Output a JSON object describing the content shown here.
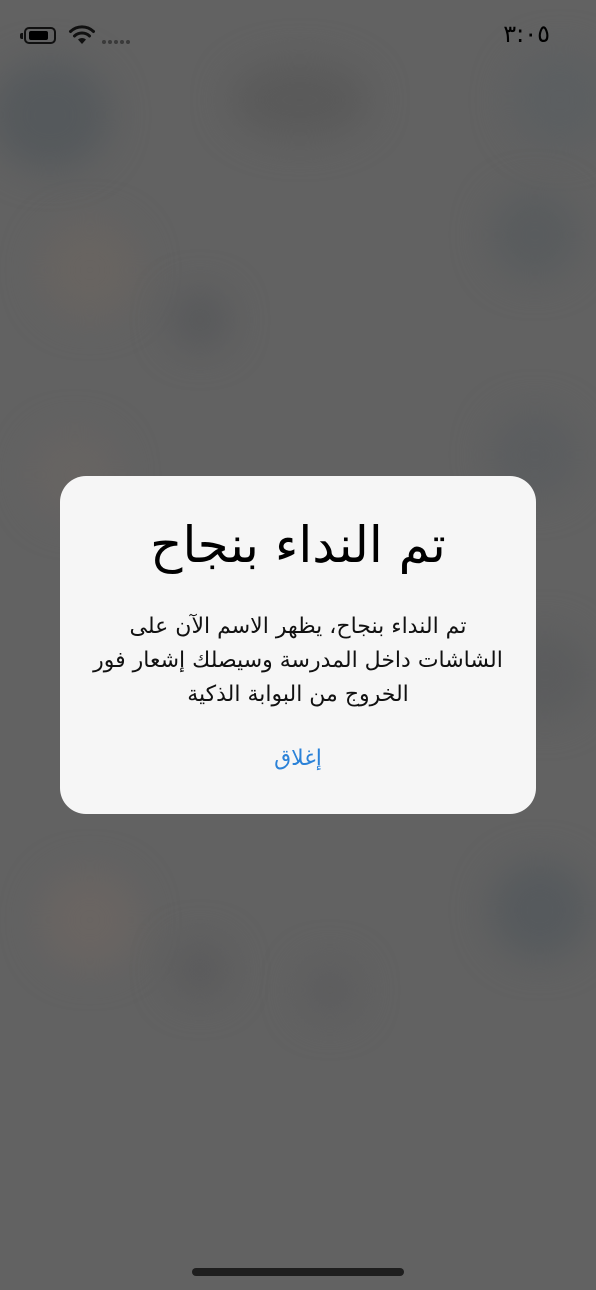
{
  "status_bar": {
    "time": "٣:٠٥",
    "battery_icon": "battery-icon",
    "wifi_icon": "wifi-icon",
    "signal_icon": "signal-dots-icon"
  },
  "alert": {
    "title": "تم النداء بنجاح",
    "message": "تم النداء بنجاح، يظهر الاسم الآن على الشاشات داخل المدرسة وسيصلك إشعار فور الخروج من البوابة الذكية",
    "close_label": "إغلاق"
  },
  "colors": {
    "overlay": "#606060",
    "alert_background": "#f6f6f6",
    "button_accent": "#2b82d8"
  }
}
